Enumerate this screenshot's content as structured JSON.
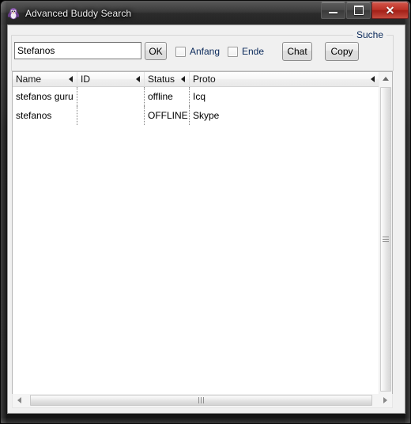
{
  "window": {
    "title": "Advanced Buddy Search",
    "icon": "penguin-app-icon",
    "controls": {
      "minimize": "minimize-icon",
      "maximize": "maximize-icon",
      "close": "✕"
    }
  },
  "search_group": {
    "legend": "Suche",
    "query_value": "Stefanos",
    "query_placeholder": "",
    "ok_label": "OK",
    "checkboxes": [
      {
        "label": "Anfang",
        "checked": false
      },
      {
        "label": "Ende",
        "checked": false
      }
    ],
    "chat_label": "Chat",
    "copy_label": "Copy"
  },
  "results": {
    "columns": [
      {
        "label": "Name",
        "sort": "sort-left-icon"
      },
      {
        "label": "ID",
        "sort": "sort-left-icon"
      },
      {
        "label": "Status",
        "sort": "sort-left-icon"
      },
      {
        "label": "Proto",
        "sort": "sort-left-icon"
      }
    ],
    "rows": [
      {
        "name": "stefanos guru",
        "id": "",
        "status": "offline",
        "proto": "Icq"
      },
      {
        "name": "stefanos",
        "id": "",
        "status": "OFFLINE",
        "proto": "Skype"
      }
    ]
  },
  "colors": {
    "label_text": "#0b2a5b",
    "close_button": "#bc3227",
    "client_bg": "#f0f0f0",
    "list_bg": "#ffffff",
    "icon_purple": "#7a4a9e"
  }
}
